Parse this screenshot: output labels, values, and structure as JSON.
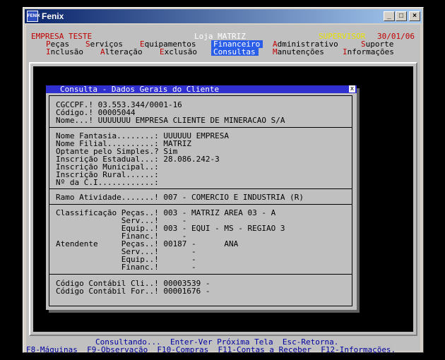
{
  "window": {
    "title": "Fenix",
    "icon_text": "FENIX",
    "controls": [
      "_",
      "□",
      "×"
    ]
  },
  "header": {
    "company": "EMPRESA TESTE",
    "store": "Loja MATRIZ",
    "user": "SUPERVISOR",
    "date": "30/01/06"
  },
  "menu_row1": [
    {
      "hot": "P",
      "rest": "eças",
      "selected": false
    },
    {
      "hot": "S",
      "rest": "erviços",
      "selected": false
    },
    {
      "hot": "E",
      "rest": "quipamentos",
      "selected": false
    },
    {
      "hot": "F",
      "rest": "inanceiro",
      "selected": true
    },
    {
      "hot": "A",
      "rest": "dministrativo",
      "selected": false
    },
    {
      "hot": "S",
      "rest": "uporte",
      "selected": false
    }
  ],
  "menu_row2": [
    {
      "hot": "I",
      "rest": "nclusão",
      "selected": false
    },
    {
      "hot": "A",
      "rest": "lteração",
      "selected": false
    },
    {
      "hot": "E",
      "rest": "xclusão",
      "selected": false
    },
    {
      "hot": "C",
      "rest": "onsultas",
      "selected": true
    },
    {
      "hot": "M",
      "rest": "anutenções",
      "selected": false
    },
    {
      "hot": "I",
      "rest": "nformações",
      "selected": false
    }
  ],
  "dialog": {
    "title": "Consulta - Dados Gerais do Cliente",
    "close": "x",
    "section1": [
      "CGCCPF.! 03.553.344/0001-16",
      "Código.! 00005044",
      "Nome...! UUUUUUU EMPRESA CLIENTE DE MINERACAO S/A"
    ],
    "section2": [
      "Nome Fantasia........: UUUUUU EMPRESA",
      "Nome Filial..........: MATRIZ",
      "Optante pelo Simples.? Sim",
      "Inscrição Estadual...: 28.086.242-3",
      "Inscrição Municipal..:",
      "Inscrição Rural......:",
      "Nº da C.I............:"
    ],
    "section3": [
      "Ramo Atividade.......! 007 - COMERCIO E INDUSTRIA (R)"
    ],
    "section4": [
      "Classificação Peças..! 003 - MATRIZ AREA 03 - A",
      "              Serv...!     -",
      "              Equip..! 003 - EQUI - MS - REGIAO 3",
      "              Financ.!     -",
      "Atendente     Peças..! 00187 -      ANA",
      "              Serv...!       -",
      "              Equip..!       -",
      "              Financ.!       -"
    ],
    "section5": [
      "Código Contábil Cli..! 00003539 -",
      "Código Contábil For..! 00001676 -"
    ]
  },
  "status": {
    "line1": "Consultando...  Enter-Ver Próxima Tela  Esc-Retorna.",
    "line2": "F8-Máquinas  F9-Observação  F10-Compras  F11-Contas a Receber  F12-Informações."
  }
}
